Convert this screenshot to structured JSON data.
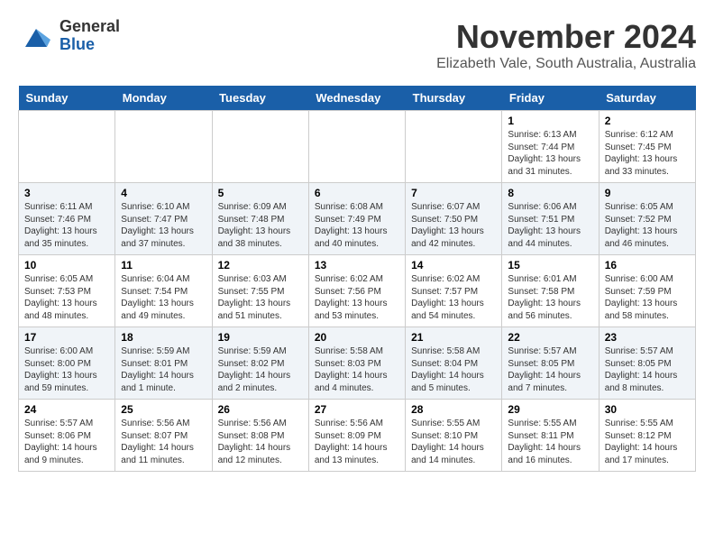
{
  "header": {
    "logo": {
      "general": "General",
      "blue": "Blue"
    },
    "title": "November 2024",
    "subtitle": "Elizabeth Vale, South Australia, Australia"
  },
  "calendar": {
    "weekdays": [
      "Sunday",
      "Monday",
      "Tuesday",
      "Wednesday",
      "Thursday",
      "Friday",
      "Saturday"
    ],
    "weeks": [
      [
        {
          "day": "",
          "info": ""
        },
        {
          "day": "",
          "info": ""
        },
        {
          "day": "",
          "info": ""
        },
        {
          "day": "",
          "info": ""
        },
        {
          "day": "",
          "info": ""
        },
        {
          "day": "1",
          "info": "Sunrise: 6:13 AM\nSunset: 7:44 PM\nDaylight: 13 hours and 31 minutes."
        },
        {
          "day": "2",
          "info": "Sunrise: 6:12 AM\nSunset: 7:45 PM\nDaylight: 13 hours and 33 minutes."
        }
      ],
      [
        {
          "day": "3",
          "info": "Sunrise: 6:11 AM\nSunset: 7:46 PM\nDaylight: 13 hours and 35 minutes."
        },
        {
          "day": "4",
          "info": "Sunrise: 6:10 AM\nSunset: 7:47 PM\nDaylight: 13 hours and 37 minutes."
        },
        {
          "day": "5",
          "info": "Sunrise: 6:09 AM\nSunset: 7:48 PM\nDaylight: 13 hours and 38 minutes."
        },
        {
          "day": "6",
          "info": "Sunrise: 6:08 AM\nSunset: 7:49 PM\nDaylight: 13 hours and 40 minutes."
        },
        {
          "day": "7",
          "info": "Sunrise: 6:07 AM\nSunset: 7:50 PM\nDaylight: 13 hours and 42 minutes."
        },
        {
          "day": "8",
          "info": "Sunrise: 6:06 AM\nSunset: 7:51 PM\nDaylight: 13 hours and 44 minutes."
        },
        {
          "day": "9",
          "info": "Sunrise: 6:05 AM\nSunset: 7:52 PM\nDaylight: 13 hours and 46 minutes."
        }
      ],
      [
        {
          "day": "10",
          "info": "Sunrise: 6:05 AM\nSunset: 7:53 PM\nDaylight: 13 hours and 48 minutes."
        },
        {
          "day": "11",
          "info": "Sunrise: 6:04 AM\nSunset: 7:54 PM\nDaylight: 13 hours and 49 minutes."
        },
        {
          "day": "12",
          "info": "Sunrise: 6:03 AM\nSunset: 7:55 PM\nDaylight: 13 hours and 51 minutes."
        },
        {
          "day": "13",
          "info": "Sunrise: 6:02 AM\nSunset: 7:56 PM\nDaylight: 13 hours and 53 minutes."
        },
        {
          "day": "14",
          "info": "Sunrise: 6:02 AM\nSunset: 7:57 PM\nDaylight: 13 hours and 54 minutes."
        },
        {
          "day": "15",
          "info": "Sunrise: 6:01 AM\nSunset: 7:58 PM\nDaylight: 13 hours and 56 minutes."
        },
        {
          "day": "16",
          "info": "Sunrise: 6:00 AM\nSunset: 7:59 PM\nDaylight: 13 hours and 58 minutes."
        }
      ],
      [
        {
          "day": "17",
          "info": "Sunrise: 6:00 AM\nSunset: 8:00 PM\nDaylight: 13 hours and 59 minutes."
        },
        {
          "day": "18",
          "info": "Sunrise: 5:59 AM\nSunset: 8:01 PM\nDaylight: 14 hours and 1 minute."
        },
        {
          "day": "19",
          "info": "Sunrise: 5:59 AM\nSunset: 8:02 PM\nDaylight: 14 hours and 2 minutes."
        },
        {
          "day": "20",
          "info": "Sunrise: 5:58 AM\nSunset: 8:03 PM\nDaylight: 14 hours and 4 minutes."
        },
        {
          "day": "21",
          "info": "Sunrise: 5:58 AM\nSunset: 8:04 PM\nDaylight: 14 hours and 5 minutes."
        },
        {
          "day": "22",
          "info": "Sunrise: 5:57 AM\nSunset: 8:05 PM\nDaylight: 14 hours and 7 minutes."
        },
        {
          "day": "23",
          "info": "Sunrise: 5:57 AM\nSunset: 8:05 PM\nDaylight: 14 hours and 8 minutes."
        }
      ],
      [
        {
          "day": "24",
          "info": "Sunrise: 5:57 AM\nSunset: 8:06 PM\nDaylight: 14 hours and 9 minutes."
        },
        {
          "day": "25",
          "info": "Sunrise: 5:56 AM\nSunset: 8:07 PM\nDaylight: 14 hours and 11 minutes."
        },
        {
          "day": "26",
          "info": "Sunrise: 5:56 AM\nSunset: 8:08 PM\nDaylight: 14 hours and 12 minutes."
        },
        {
          "day": "27",
          "info": "Sunrise: 5:56 AM\nSunset: 8:09 PM\nDaylight: 14 hours and 13 minutes."
        },
        {
          "day": "28",
          "info": "Sunrise: 5:55 AM\nSunset: 8:10 PM\nDaylight: 14 hours and 14 minutes."
        },
        {
          "day": "29",
          "info": "Sunrise: 5:55 AM\nSunset: 8:11 PM\nDaylight: 14 hours and 16 minutes."
        },
        {
          "day": "30",
          "info": "Sunrise: 5:55 AM\nSunset: 8:12 PM\nDaylight: 14 hours and 17 minutes."
        }
      ]
    ]
  }
}
